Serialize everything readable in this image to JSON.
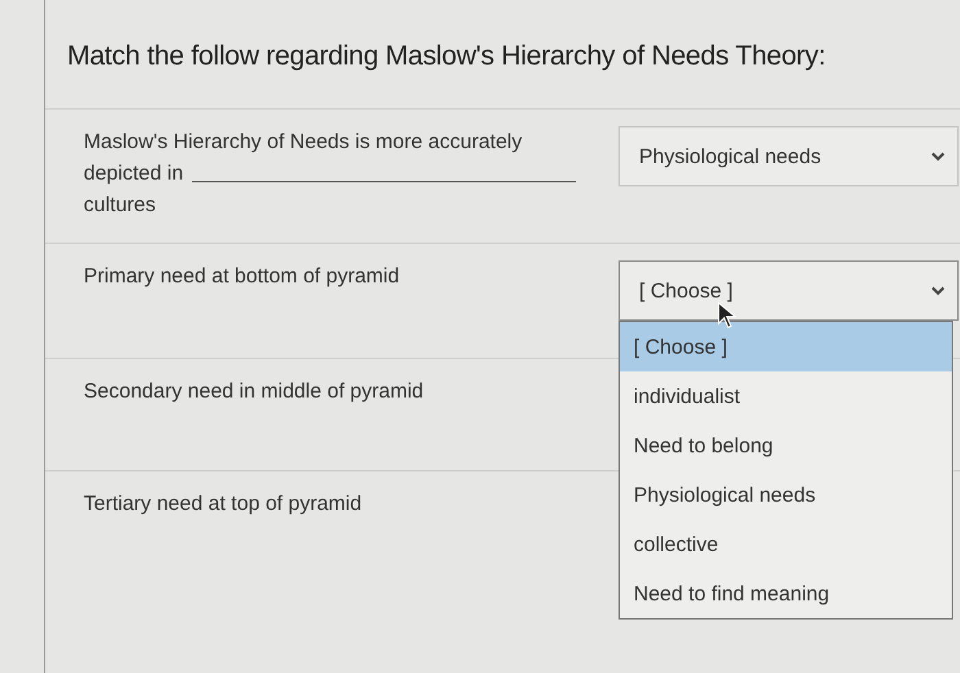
{
  "title": "Match the follow regarding Maslow's Hierarchy of Needs Theory:",
  "questions": [
    {
      "kind": "blank",
      "text_before": [
        "Maslow's Hierarchy of Needs is more accurately",
        "depicted in"
      ],
      "text_after": "cultures",
      "select": {
        "value": "Physiological needs",
        "expanded": false
      }
    },
    {
      "kind": "plain",
      "text": "Primary need at bottom of pyramid",
      "select": {
        "value": "[ Choose ]",
        "expanded": true,
        "options": [
          {
            "label": "[ Choose ]",
            "selected": true
          },
          {
            "label": "individualist",
            "selected": false
          },
          {
            "label": "Need to belong",
            "selected": false
          },
          {
            "label": "Physiological needs",
            "selected": false
          },
          {
            "label": "collective",
            "selected": false
          },
          {
            "label": "Need to find meaning",
            "selected": false
          }
        ]
      }
    },
    {
      "kind": "plain",
      "text": "Secondary need in middle of pyramid"
    },
    {
      "kind": "plain",
      "text": "Tertiary need at top of pyramid"
    }
  ]
}
